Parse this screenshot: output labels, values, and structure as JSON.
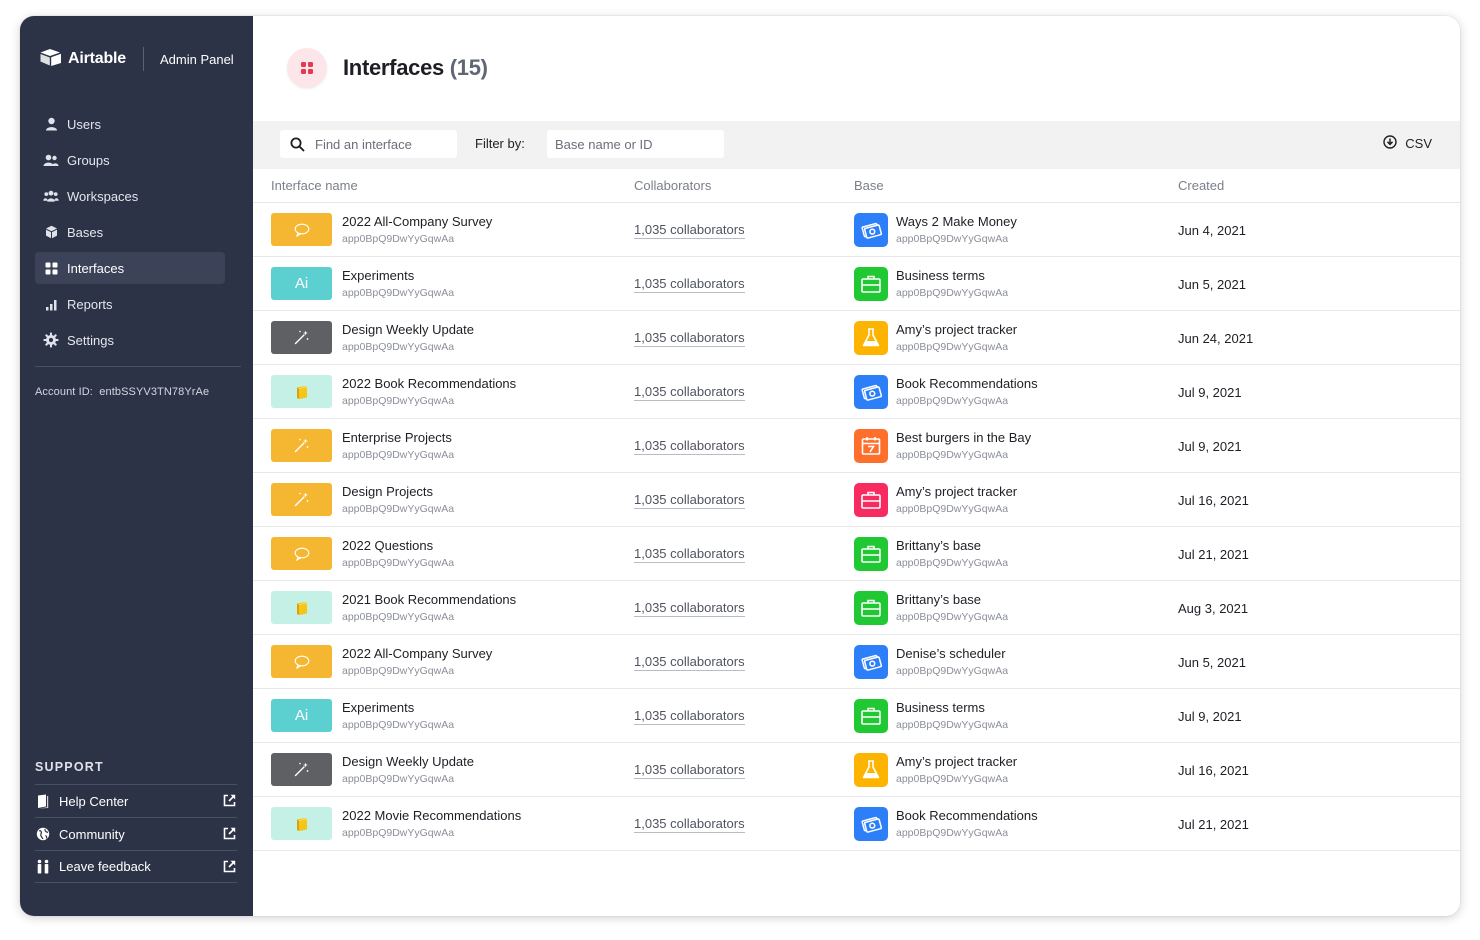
{
  "brand": {
    "name": "Airtable",
    "panel": "Admin Panel"
  },
  "nav": [
    {
      "label": "Users",
      "icon": "user-icon"
    },
    {
      "label": "Groups",
      "icon": "group-icon"
    },
    {
      "label": "Workspaces",
      "icon": "workspaces-icon"
    },
    {
      "label": "Bases",
      "icon": "cube-icon"
    },
    {
      "label": "Interfaces",
      "icon": "grid-icon",
      "active": true
    },
    {
      "label": "Reports",
      "icon": "bar-chart-icon"
    },
    {
      "label": "Settings",
      "icon": "gear-icon"
    }
  ],
  "account": {
    "label": "Account ID:",
    "id": "entbSSYV3TN78YrAe"
  },
  "support": {
    "title": "SUPPORT",
    "items": [
      {
        "label": "Help Center",
        "icon": "book-icon"
      },
      {
        "label": "Community",
        "icon": "globe-icon"
      },
      {
        "label": "Leave feedback",
        "icon": "people-icon"
      }
    ]
  },
  "header": {
    "title": "Interfaces",
    "count": "(15)"
  },
  "toolbar": {
    "search_placeholder": "Find an interface",
    "filter_label": "Filter by:",
    "filter_placeholder": "Base name or ID",
    "csv_label": "CSV"
  },
  "table": {
    "columns": {
      "name": "Interface name",
      "collaborators": "Collaborators",
      "base": "Base",
      "created": "Created"
    },
    "rows": [
      {
        "name": "2022 All-Company Survey",
        "id": "app0BpQ9DwYyGqwAa",
        "thumb": "yellow",
        "thumb_icon": "chat-bubble-icon",
        "collaborators": "1,035 collaborators",
        "base": "Ways 2 Make Money",
        "base_id": "app0BpQ9DwYyGqwAa",
        "base_color": "#2d7ff9",
        "base_icon": "money-icon",
        "created": "Jun 4, 2021"
      },
      {
        "name": "Experiments",
        "id": "app0BpQ9DwYyGqwAa",
        "thumb": "teal",
        "thumb_icon": "ai-icon",
        "thumb_text": "Ai",
        "collaborators": "1,035 collaborators",
        "base": "Business terms",
        "base_id": "app0BpQ9DwYyGqwAa",
        "base_color": "#20c933",
        "base_icon": "briefcase-icon",
        "created": "Jun 5, 2021"
      },
      {
        "name": "Design Weekly Update",
        "id": "app0BpQ9DwYyGqwAa",
        "thumb": "gray",
        "thumb_icon": "magic-wand-icon",
        "collaborators": "1,035 collaborators",
        "base": "Amy’s project tracker",
        "base_id": "app0BpQ9DwYyGqwAa",
        "base_color": "#fcb400",
        "base_icon": "flask-icon",
        "created": "Jun 24, 2021"
      },
      {
        "name": "2022 Book Recommendations",
        "id": "app0BpQ9DwYyGqwAa",
        "thumb": "mint",
        "thumb_icon": "book-cube-icon",
        "collaborators": "1,035 collaborators",
        "base": "Book Recommendations",
        "base_id": "app0BpQ9DwYyGqwAa",
        "base_color": "#2d7ff9",
        "base_icon": "money-icon",
        "created": "Jul 9, 2021"
      },
      {
        "name": "Enterprise Projects",
        "id": "app0BpQ9DwYyGqwAa",
        "thumb": "yellow",
        "thumb_icon": "magic-wand-icon",
        "collaborators": "1,035 collaborators",
        "base": "Best burgers in the Bay",
        "base_id": "app0BpQ9DwYyGqwAa",
        "base_color": "#ff6f2c",
        "base_icon": "calendar-icon",
        "created": "Jul 9, 2021"
      },
      {
        "name": "Design Projects",
        "id": "app0BpQ9DwYyGqwAa",
        "thumb": "yellow",
        "thumb_icon": "magic-wand-icon",
        "collaborators": "1,035 collaborators",
        "base": "Amy’s project tracker",
        "base_id": "app0BpQ9DwYyGqwAa",
        "base_color": "#f82b60",
        "base_icon": "briefcase-icon",
        "created": "Jul 16, 2021"
      },
      {
        "name": "2022 Questions",
        "id": "app0BpQ9DwYyGqwAa",
        "thumb": "yellow",
        "thumb_icon": "chat-bubble-icon",
        "collaborators": "1,035 collaborators",
        "base": "Brittany’s base",
        "base_id": "app0BpQ9DwYyGqwAa",
        "base_color": "#20c933",
        "base_icon": "briefcase-icon",
        "created": "Jul 21, 2021"
      },
      {
        "name": "2021 Book Recommendations",
        "id": "app0BpQ9DwYyGqwAa",
        "thumb": "mint",
        "thumb_icon": "book-cube-icon",
        "collaborators": "1,035 collaborators",
        "base": "Brittany’s base",
        "base_id": "app0BpQ9DwYyGqwAa",
        "base_color": "#20c933",
        "base_icon": "briefcase-icon",
        "created": "Aug 3, 2021"
      },
      {
        "name": "2022 All-Company Survey",
        "id": "app0BpQ9DwYyGqwAa",
        "thumb": "yellow",
        "thumb_icon": "chat-bubble-icon",
        "collaborators": "1,035 collaborators",
        "base": "Denise’s scheduler",
        "base_id": "app0BpQ9DwYyGqwAa",
        "base_color": "#2d7ff9",
        "base_icon": "money-icon",
        "created": "Jun 5, 2021"
      },
      {
        "name": "Experiments",
        "id": "app0BpQ9DwYyGqwAa",
        "thumb": "teal",
        "thumb_icon": "ai-icon",
        "thumb_text": "Ai",
        "collaborators": "1,035 collaborators",
        "base": "Business terms",
        "base_id": "app0BpQ9DwYyGqwAa",
        "base_color": "#20c933",
        "base_icon": "briefcase-icon",
        "created": "Jul 9, 2021"
      },
      {
        "name": "Design Weekly Update",
        "id": "app0BpQ9DwYyGqwAa",
        "thumb": "gray",
        "thumb_icon": "magic-wand-icon",
        "collaborators": "1,035 collaborators",
        "base": "Amy’s project tracker",
        "base_id": "app0BpQ9DwYyGqwAa",
        "base_color": "#fcb400",
        "base_icon": "flask-icon",
        "created": "Jul 16, 2021"
      },
      {
        "name": "2022 Movie Recommendations",
        "id": "app0BpQ9DwYyGqwAa",
        "thumb": "mint",
        "thumb_icon": "book-cube-icon",
        "collaborators": "1,035 collaborators",
        "base": "Book Recommendations",
        "base_id": "app0BpQ9DwYyGqwAa",
        "base_color": "#2d7ff9",
        "base_icon": "money-icon",
        "created": "Jul 21, 2021"
      }
    ]
  }
}
